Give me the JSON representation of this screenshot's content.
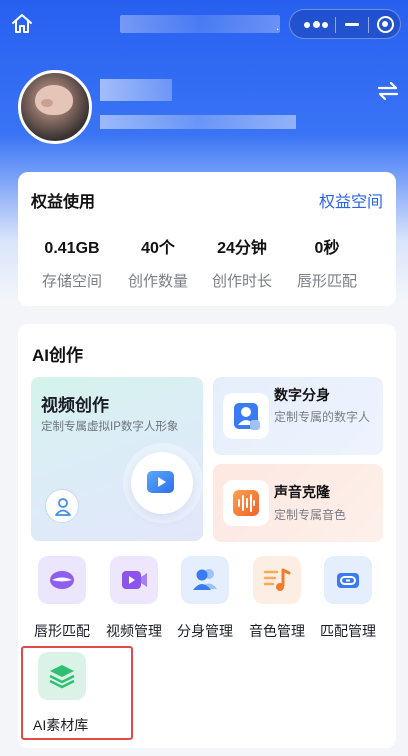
{
  "nav": {},
  "profile": {},
  "rights": {
    "title": "权益使用",
    "link_label": "权益空间",
    "stats": [
      {
        "value": "0.41GB",
        "label": "存储空间"
      },
      {
        "value": "40个",
        "label": "创作数量"
      },
      {
        "value": "24分钟",
        "label": "创作时长"
      },
      {
        "value": "0秒",
        "label": "唇形匹配"
      }
    ]
  },
  "ai": {
    "title": "AI创作",
    "video": {
      "title": "视频创作",
      "subtitle": "定制专属虚拟IP数字人形象"
    },
    "digital": {
      "title": "数字分身",
      "subtitle": "定制专属的数字人"
    },
    "voice": {
      "title": "声音克隆",
      "subtitle": "定制专属音色"
    },
    "tools": [
      {
        "label": "唇形匹配",
        "icon": "lips-icon"
      },
      {
        "label": "视频管理",
        "icon": "video-icon"
      },
      {
        "label": "分身管理",
        "icon": "users-icon"
      },
      {
        "label": "音色管理",
        "icon": "music-icon"
      },
      {
        "label": "匹配管理",
        "icon": "link-icon"
      },
      {
        "label": "AI素材库",
        "icon": "layers-icon"
      }
    ]
  },
  "colors": {
    "primary": "#2b63ec",
    "header": "#2760f0",
    "highlight_border": "#e24a4a"
  }
}
